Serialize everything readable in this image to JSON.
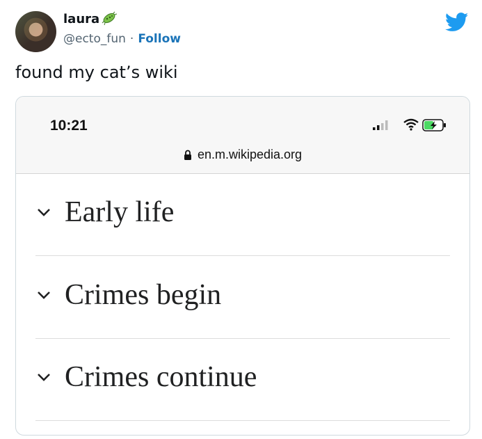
{
  "tweet": {
    "author_name": "laura",
    "handle": "@ecto_fun",
    "separator": "·",
    "follow_label": "Follow",
    "text": "found my cat’s wiki"
  },
  "screenshot": {
    "status_time": "10:21",
    "url": "en.m.wikipedia.org",
    "sections": [
      {
        "title": "Early life"
      },
      {
        "title": "Crimes begin"
      },
      {
        "title": "Crimes continue"
      }
    ]
  },
  "icons": {
    "twitter": "twitter-bird-icon",
    "badge": "bacteria-badge-icon",
    "lock": "lock-icon",
    "chevron": "chevron-down-icon"
  },
  "colors": {
    "twitter_blue": "#1d9bf0",
    "follow_link": "#1b74b8",
    "battery_green": "#4cd964"
  }
}
